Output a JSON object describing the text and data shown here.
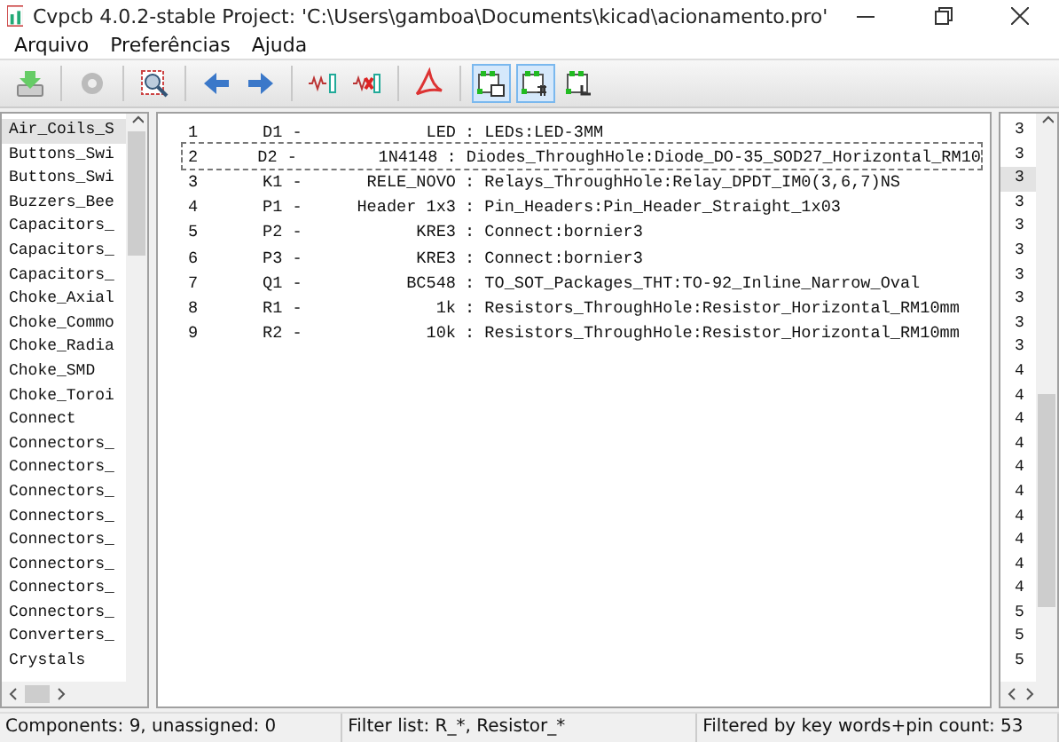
{
  "window": {
    "title": "Cvpcb 4.0.2-stable  Project: 'C:\\Users\\gamboa\\Documents\\kicad\\acionamento.pro'"
  },
  "menu": [
    "Arquivo",
    "Preferências",
    "Ajuda"
  ],
  "toolbar": [
    {
      "kind": "save",
      "pressed": false
    },
    {
      "kind": "sep"
    },
    {
      "kind": "gear",
      "pressed": false
    },
    {
      "kind": "sep"
    },
    {
      "kind": "inspect",
      "pressed": false
    },
    {
      "kind": "sep"
    },
    {
      "kind": "left",
      "pressed": false
    },
    {
      "kind": "right",
      "pressed": false
    },
    {
      "kind": "sep"
    },
    {
      "kind": "assign",
      "pressed": false
    },
    {
      "kind": "delete",
      "pressed": false
    },
    {
      "kind": "sep"
    },
    {
      "kind": "pdf",
      "pressed": false
    },
    {
      "kind": "sep"
    },
    {
      "kind": "filter_kw",
      "pressed": true
    },
    {
      "kind": "filter_pin",
      "pressed": true
    },
    {
      "kind": "filter_lib",
      "pressed": false
    }
  ],
  "libraries": [
    {
      "label": "Air_Coils_S",
      "selected": true
    },
    {
      "label": "Buttons_Swi",
      "selected": false
    },
    {
      "label": "Buttons_Swi",
      "selected": false
    },
    {
      "label": "Buzzers_Bee",
      "selected": false
    },
    {
      "label": "Capacitors_",
      "selected": false
    },
    {
      "label": "Capacitors_",
      "selected": false
    },
    {
      "label": "Capacitors_",
      "selected": false
    },
    {
      "label": "Choke_Axial",
      "selected": false
    },
    {
      "label": "Choke_Commo",
      "selected": false
    },
    {
      "label": "Choke_Radia",
      "selected": false
    },
    {
      "label": "Choke_SMD",
      "selected": false
    },
    {
      "label": "Choke_Toroi",
      "selected": false
    },
    {
      "label": "Connect",
      "selected": false
    },
    {
      "label": "Connectors_",
      "selected": false
    },
    {
      "label": "Connectors_",
      "selected": false
    },
    {
      "label": "Connectors_",
      "selected": false
    },
    {
      "label": "Connectors_",
      "selected": false
    },
    {
      "label": "Connectors_",
      "selected": false
    },
    {
      "label": "Connectors_",
      "selected": false
    },
    {
      "label": "Connectors_",
      "selected": false
    },
    {
      "label": "Connectors_",
      "selected": false
    },
    {
      "label": "Converters_",
      "selected": false
    },
    {
      "label": "Crystals",
      "selected": false
    }
  ],
  "components": [
    {
      "num": "1",
      "ref": "D1 -",
      "value": "LED",
      "footprint": ": LEDs:LED-3MM",
      "selected": false
    },
    {
      "num": "2",
      "ref": "D2 -",
      "value": "1N4148",
      "footprint": ": Diodes_ThroughHole:Diode_DO-35_SOD27_Horizontal_RM10",
      "selected": true
    },
    {
      "num": "3",
      "ref": "K1 -",
      "value": "RELE_NOVO",
      "footprint": ": Relays_ThroughHole:Relay_DPDT_IM0(3,6,7)NS",
      "selected": false
    },
    {
      "num": "4",
      "ref": "P1 -",
      "value": "Header 1x3",
      "footprint": ": Pin_Headers:Pin_Header_Straight_1x03",
      "selected": false
    },
    {
      "num": "5",
      "ref": "P2 -",
      "value": "KRE3",
      "footprint": ": Connect:bornier3",
      "selected": false
    },
    {
      "num": "6",
      "ref": "P3 -",
      "value": "KRE3",
      "footprint": ": Connect:bornier3",
      "selected": false
    },
    {
      "num": "7",
      "ref": "Q1 -",
      "value": "BC548",
      "footprint": ": TO_SOT_Packages_THT:TO-92_Inline_Narrow_Oval",
      "selected": false
    },
    {
      "num": "8",
      "ref": "R1 -",
      "value": "1k",
      "footprint": ": Resistors_ThroughHole:Resistor_Horizontal_RM10mm",
      "selected": false
    },
    {
      "num": "9",
      "ref": "R2 -",
      "value": "10k",
      "footprint": ": Resistors_ThroughHole:Resistor_Horizontal_RM10mm",
      "selected": false
    }
  ],
  "footprints": [
    {
      "label": "3",
      "selected": false
    },
    {
      "label": "3",
      "selected": false
    },
    {
      "label": "3",
      "selected": true
    },
    {
      "label": "3",
      "selected": false
    },
    {
      "label": "3",
      "selected": false
    },
    {
      "label": "3",
      "selected": false
    },
    {
      "label": "3",
      "selected": false
    },
    {
      "label": "3",
      "selected": false
    },
    {
      "label": "3",
      "selected": false
    },
    {
      "label": "3",
      "selected": false
    },
    {
      "label": "4",
      "selected": false
    },
    {
      "label": "4",
      "selected": false
    },
    {
      "label": "4",
      "selected": false
    },
    {
      "label": "4",
      "selected": false
    },
    {
      "label": "4",
      "selected": false
    },
    {
      "label": "4",
      "selected": false
    },
    {
      "label": "4",
      "selected": false
    },
    {
      "label": "4",
      "selected": false
    },
    {
      "label": "4",
      "selected": false
    },
    {
      "label": "4",
      "selected": false
    },
    {
      "label": "5",
      "selected": false
    },
    {
      "label": "5",
      "selected": false
    },
    {
      "label": "5",
      "selected": false
    }
  ],
  "status_bar": [
    "Components: 9, unassigned: 0",
    "Filter list: R_*, Resistor_*",
    "Filtered by key words+pin count: 53"
  ]
}
